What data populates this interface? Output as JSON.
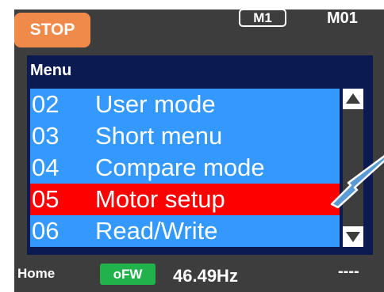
{
  "header": {
    "stop_label": "STOP",
    "motor_badge": "M1",
    "motor_code": "M01"
  },
  "menu": {
    "title": "Menu",
    "items": [
      {
        "number": "02",
        "label": "User mode"
      },
      {
        "number": "03",
        "label": "Short menu"
      },
      {
        "number": "04",
        "label": "Compare mode"
      },
      {
        "number": "05",
        "label": "Motor setup",
        "selected": true
      },
      {
        "number": "06",
        "label": "Read/Write"
      }
    ]
  },
  "status": {
    "home_label": "Home",
    "direction_badge": "oFW",
    "frequency": "46.49Hz",
    "extra": "----"
  },
  "colors": {
    "stop_button": "#f08a4b",
    "menu_item_bg": "#3399ff",
    "selected_item_bg": "#ff0000",
    "header_bg": "#0c1a52",
    "direction_badge": "#22b24c",
    "panel_bg": "#3d3d3d",
    "pointer_arrow": "#5b9bd5"
  },
  "icons": {
    "scroll_up": "triangle-up-icon",
    "scroll_down": "triangle-down-icon",
    "pointer": "arrow-pointer-icon"
  }
}
